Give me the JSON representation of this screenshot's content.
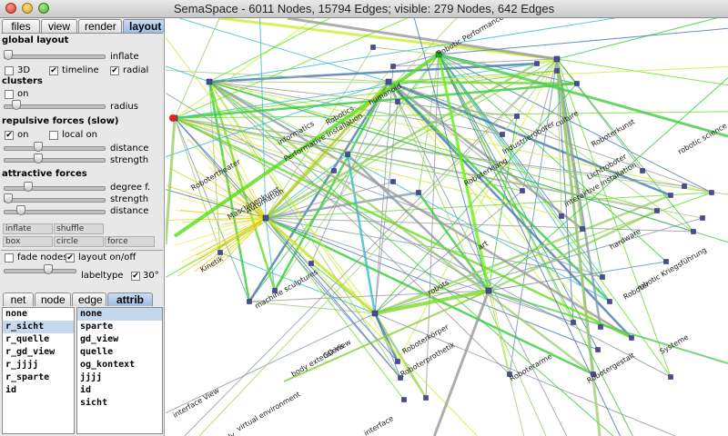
{
  "window": {
    "title": "SemaSpace - 6011 Nodes, 15794 Edges; visible: 279 Nodes, 642 Edges"
  },
  "top_tabs": [
    "files",
    "view",
    "render",
    "layout"
  ],
  "global_layout": {
    "heading": "global layout",
    "inflate_label": "inflate",
    "options": [
      {
        "label": "3D",
        "checked": false
      },
      {
        "label": "timeline",
        "checked": true
      },
      {
        "label": "radial",
        "checked": true
      }
    ]
  },
  "clusters": {
    "heading": "clusters",
    "on_label": "on",
    "on_checked": false,
    "radius_label": "radius"
  },
  "repulsive": {
    "heading": "repulsive forces (slow)",
    "on_label": "on",
    "on_checked": true,
    "local_label": "local on",
    "local_checked": false,
    "distance_label": "distance",
    "strength_label": "strength"
  },
  "attractive": {
    "heading": "attractive forces",
    "degree_label": "degree f.",
    "strength_label": "strength",
    "distance_label": "distance"
  },
  "buttons": [
    "inflate",
    "shuffle",
    "box",
    "circle",
    "force"
  ],
  "bottom_opts": {
    "fade_label": "fade nodes",
    "fade_checked": false,
    "layout_label": "layout on/off",
    "layout_checked": true,
    "labeltype_label": "labeltype",
    "deg_label": "30°",
    "deg_checked": true
  },
  "bottom_tabs": [
    "net",
    "node",
    "edge",
    "attrib"
  ],
  "attrib_left": [
    "none",
    "r_sicht",
    "r_quelle",
    "r_gd_view",
    "r_jjjj",
    "r_sparte",
    "id"
  ],
  "attrib_right": [
    "none",
    "sparte",
    "gd_view",
    "quelle",
    "og_kontext",
    "jjjj",
    "id",
    "sicht"
  ],
  "graph": {
    "labels": [
      "Robotic Performance",
      "humanoid",
      "Robotics",
      "Performative Installation",
      "informatics",
      "culture",
      "Industrieroboter",
      "Roboterkunst",
      "Lichtroboter",
      "interaktive Installation",
      "hardware",
      "robotic science",
      "Roboter",
      "Robotergestalt",
      "Roboterprothetik",
      "Roboterkörper",
      "Roboterarme",
      "robotic Kriegsführung",
      "Systeme",
      "machine sculptures",
      "body extensions",
      "Automation",
      "Maschinenkunst",
      "Roboterklang",
      "robots",
      "GD-View",
      "interface",
      "art",
      "interface View",
      "virtual environment",
      "body",
      "Robotertheater",
      "Kinetik"
    ]
  }
}
